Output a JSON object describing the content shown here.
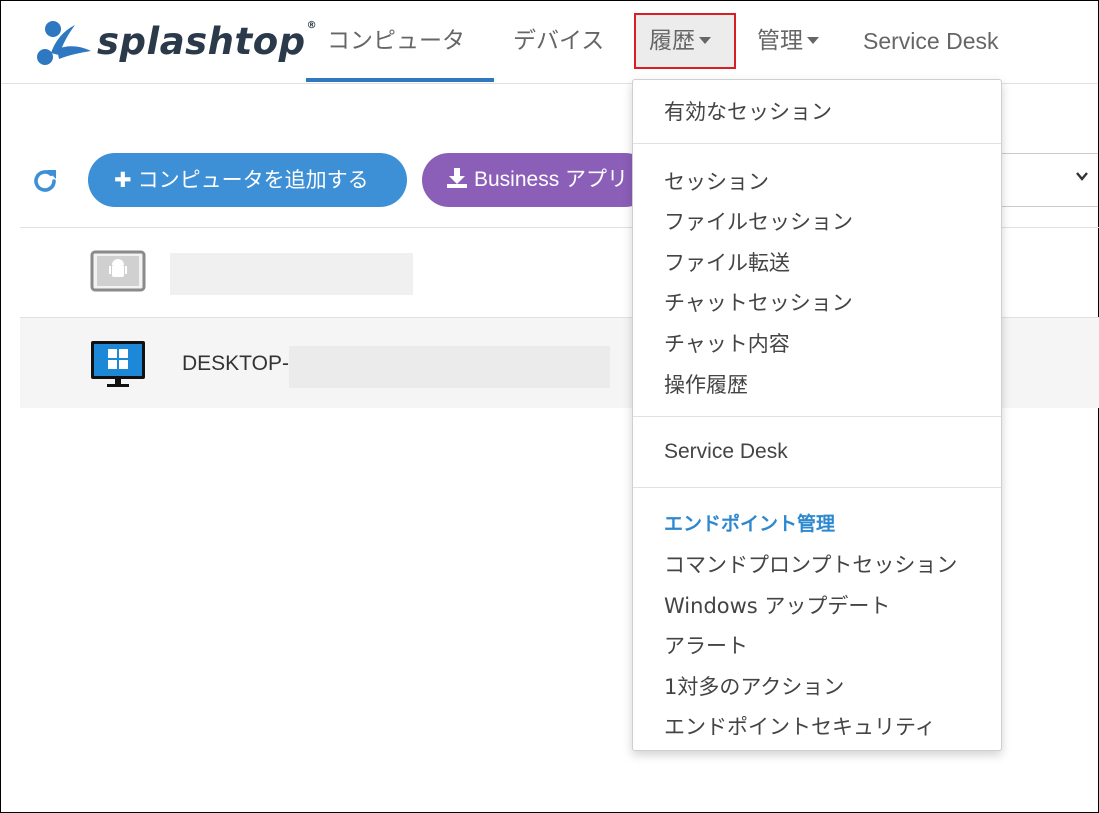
{
  "header": {
    "logo_text": "splashtop",
    "logo_mark": "®",
    "nav": [
      {
        "label": "コンピュータ",
        "active": true
      },
      {
        "label": "デバイス",
        "active": false
      },
      {
        "label": "履歴",
        "active": false,
        "has_caret": true,
        "highlighted": true
      },
      {
        "label": "管理",
        "active": false,
        "has_caret": true
      },
      {
        "label": "Service Desk",
        "active": false
      }
    ]
  },
  "toolbar": {
    "refresh_icon": "refresh-icon",
    "add_computer_label": "コンピュータを追加する",
    "business_app_label": "Business アプリ"
  },
  "devices": [
    {
      "icon": "android-device-icon",
      "name": ""
    },
    {
      "icon": "windows-monitor-icon",
      "name": "DESKTOP-"
    }
  ],
  "history_menu": {
    "group1": [
      "有効なセッション"
    ],
    "group2": [
      "セッション",
      "ファイルセッション",
      "ファイル転送",
      "チャットセッション",
      "チャット内容",
      "操作履歴"
    ],
    "group3": [
      "Service Desk"
    ],
    "endpoint_header": "エンドポイント管理",
    "group4": [
      "コマンドプロンプトセッション",
      "Windows アップデート",
      "アラート",
      "1対多のアクション",
      "エンドポイントセキュリティ"
    ]
  },
  "colors": {
    "brand_blue": "#3d8fd6",
    "purple": "#8b5fb8",
    "highlight_red": "#d81f26",
    "nav_underline": "#2d78c0",
    "menu_header": "#2d88cf"
  }
}
